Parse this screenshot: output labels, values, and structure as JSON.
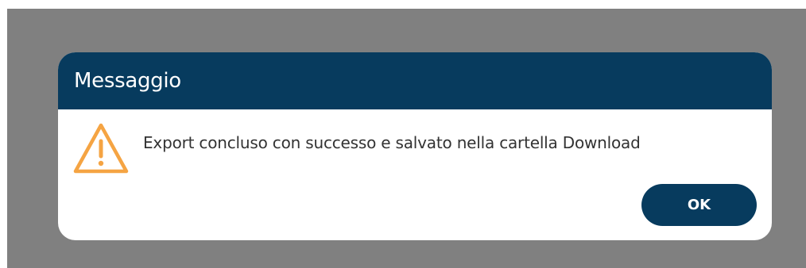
{
  "dialog": {
    "title": "Messaggio",
    "message": "Export concluso con successo e salvato nella cartella Download",
    "icon": "warning-icon",
    "ok_label": "OK"
  },
  "colors": {
    "overlay": "#808080",
    "header": "#073b5e",
    "button": "#073b5e",
    "warning": "#f5a443"
  }
}
